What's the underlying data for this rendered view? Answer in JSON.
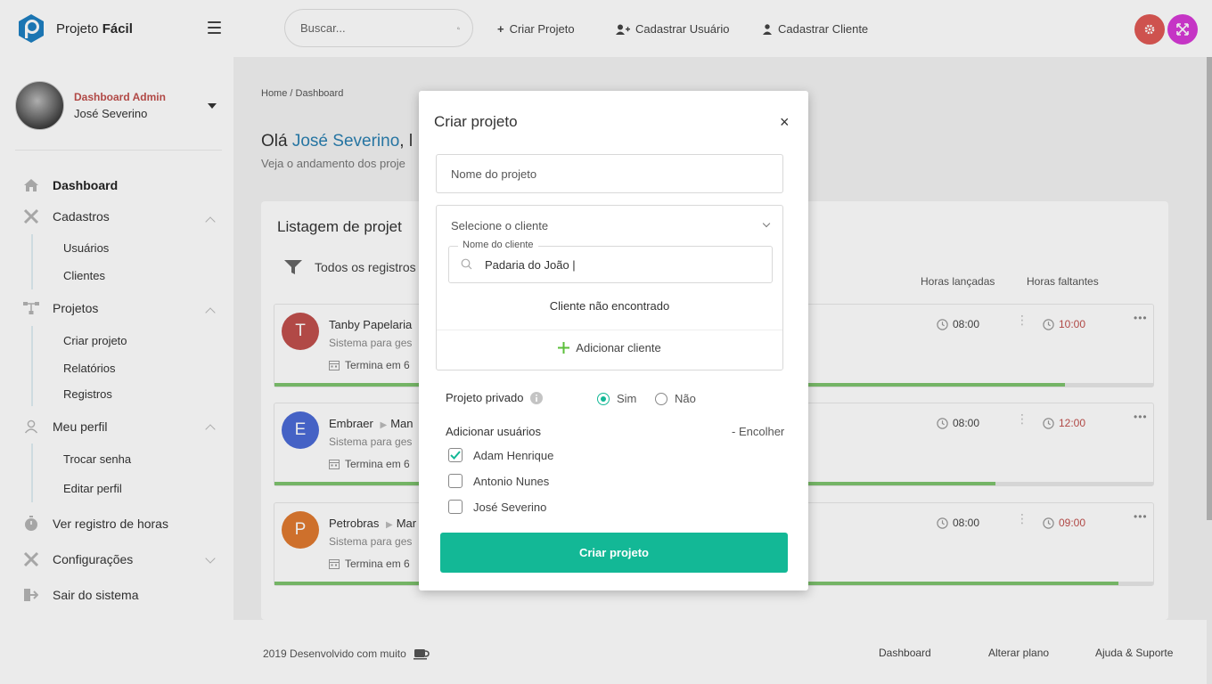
{
  "header": {
    "brand_light": "Projeto",
    "brand_bold": "Fácil",
    "search_placeholder": "Buscar...",
    "links": [
      "Criar Projeto",
      "Cadastrar Usuário",
      "Cadastrar Cliente"
    ]
  },
  "sidebar": {
    "role": "Dashboard Admin",
    "user": "José Severino",
    "nav": {
      "dashboard": "Dashboard",
      "cadastros": "Cadastros",
      "usuarios": "Usuários",
      "clientes": "Clientes",
      "projetos": "Projetos",
      "criar_projeto": "Criar projeto",
      "relatorios": "Relatórios",
      "registros": "Registros",
      "meu_perfil": "Meu perfil",
      "trocar_senha": "Trocar senha",
      "editar_perfil": "Editar perfil",
      "ver_registro": "Ver registro de horas",
      "configuracoes": "Configurações",
      "sair": "Sair do sistema"
    }
  },
  "main": {
    "breadcrumb": "Home / Dashboard",
    "greet_prefix": "Olá ",
    "greet_name": "José Severino",
    "greet_suffix": ", l",
    "greet_sub": "Veja o andamento dos proje",
    "card_title": "Listagem de projet",
    "filter_label": "Todos os registros",
    "col_hours_logged": "Horas lançadas",
    "col_hours_left": "Horas faltantes",
    "rows": [
      {
        "initial": "T",
        "name": "Tanby Papelaria",
        "desc": "Sistema para ges",
        "ends": "Termina em 6",
        "logged": "08:00",
        "left": "10:00",
        "progress": 0.9,
        "color": "#c0504d"
      },
      {
        "initial": "E",
        "name": "Embraer",
        "project": "Man",
        "desc": "Sistema para ges",
        "ends": "Termina em 6",
        "logged": "08:00",
        "left": "12:00",
        "progress": 0.82,
        "color": "#4b6bd6"
      },
      {
        "initial": "P",
        "name": "Petrobras",
        "project": "Mar",
        "desc": "Sistema para ges",
        "ends": "Termina em 6",
        "logged": "08:00",
        "left": "09:00",
        "progress": 0.96,
        "color": "#e07a30"
      }
    ]
  },
  "modal": {
    "title": "Criar projeto",
    "close": "×",
    "name_placeholder": "Nome do projeto",
    "client_placeholder": "Selecione o cliente",
    "client_name_label": "Nome do cliente",
    "client_name_value": "Padaria do João |",
    "not_found": "Cliente não encontrado",
    "add_client": "Adicionar cliente",
    "private_label": "Projeto privado",
    "private_yes": "Sim",
    "private_no": "Não",
    "private_selected": "Sim",
    "add_users": "Adicionar usuários",
    "collapse": "- Encolher",
    "users": [
      {
        "name": "Adam Henrique",
        "checked": true
      },
      {
        "name": "Antonio Nunes",
        "checked": false
      },
      {
        "name": "José Severino",
        "checked": false
      }
    ],
    "submit": "Criar projeto"
  },
  "footer": {
    "copy": "2019 Desenvolvido com muito",
    "links": [
      "Dashboard",
      "Alterar plano",
      "Ajuda & Suporte"
    ]
  },
  "colors": {
    "accent": "#13b896",
    "danger": "#e05a55",
    "magenta": "#d63ad6",
    "link": "#2a7fb0"
  }
}
